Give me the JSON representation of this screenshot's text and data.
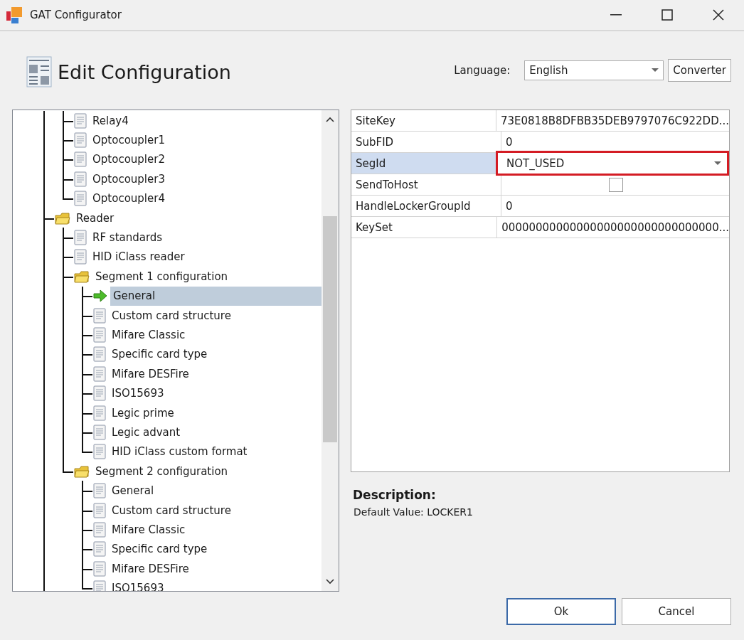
{
  "window": {
    "title": "GAT Configurator"
  },
  "header": {
    "title": "Edit Configuration"
  },
  "language": {
    "label": "Language:",
    "value": "English",
    "button": "Converter"
  },
  "tree": {
    "items": [
      {
        "children": [
          {
            "label": "Relay4",
            "selected": false
          },
          {
            "label": "Optocoupler1",
            "selected": false
          },
          {
            "label": "Optocoupler2",
            "selected": false
          },
          {
            "label": "Optocoupler3",
            "selected": false
          },
          {
            "label": "Optocoupler4",
            "selected": false
          }
        ]
      },
      {
        "label": "Reader",
        "kind": "folder",
        "selected": false,
        "children": [
          {
            "label": "RF standards",
            "selected": false
          },
          {
            "label": "HID iClass reader",
            "selected": false
          },
          {
            "label": "Segment 1 configuration",
            "kind": "folder",
            "selected": false,
            "children": [
              {
                "label": "General",
                "selected": true
              },
              {
                "label": "Custom card structure",
                "selected": false
              },
              {
                "label": "Mifare Classic",
                "selected": false
              },
              {
                "label": "Specific card type",
                "selected": false
              },
              {
                "label": "Mifare DESFire",
                "selected": false
              },
              {
                "label": "ISO15693",
                "selected": false
              },
              {
                "label": "Legic prime",
                "selected": false
              },
              {
                "label": "Legic advant",
                "selected": false
              },
              {
                "label": "HID iClass custom format",
                "selected": false
              }
            ]
          },
          {
            "label": "Segment 2 configuration",
            "kind": "folder",
            "selected": false,
            "children": [
              {
                "label": "General",
                "selected": false
              },
              {
                "label": "Custom card structure",
                "selected": false
              },
              {
                "label": "Mifare Classic",
                "selected": false
              },
              {
                "label": "Specific card type",
                "selected": false
              },
              {
                "label": "Mifare DESFire",
                "selected": false
              },
              {
                "label": "ISO15693",
                "selected": false
              }
            ]
          }
        ]
      }
    ]
  },
  "properties": [
    {
      "name": "SiteKey",
      "kind": "text",
      "value": "73E0818B8DFBB35DEB9797076C922DD...",
      "selected": false
    },
    {
      "name": "SubFID",
      "kind": "text",
      "value": "0",
      "selected": false
    },
    {
      "name": "SegId",
      "kind": "dropdown",
      "value": "NOT_USED",
      "selected": true
    },
    {
      "name": "SendToHost",
      "kind": "checkbox",
      "checked": false,
      "selected": false
    },
    {
      "name": "HandleLockerGroupId",
      "kind": "text",
      "value": "0",
      "selected": false
    },
    {
      "name": "KeySet",
      "kind": "text",
      "value": "00000000000000000000000000000000...",
      "selected": false
    }
  ],
  "description": {
    "title": "Description:",
    "text": "Default Value: LOCKER1"
  },
  "buttons": [
    {
      "label": "Ok",
      "default": true
    },
    {
      "label": "Cancel",
      "default": false
    }
  ]
}
